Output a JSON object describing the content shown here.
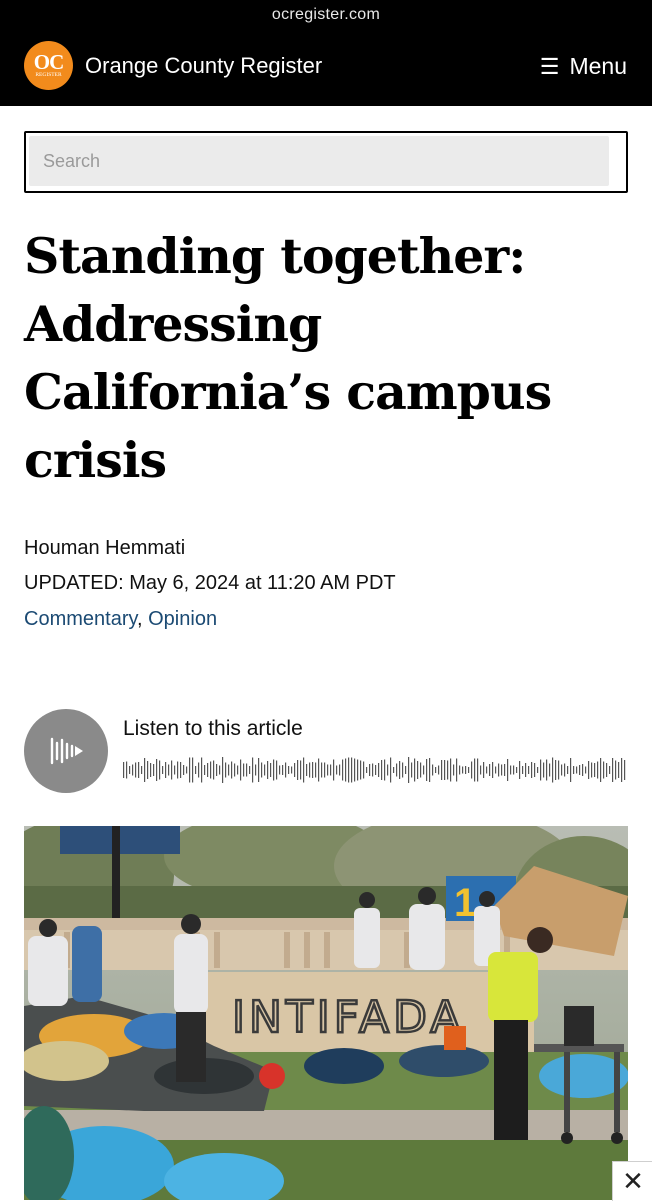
{
  "browser": {
    "url": "ocregister.com"
  },
  "header": {
    "logo_main": "OC",
    "logo_sub": "REGISTER",
    "site_name": "Orange County Register",
    "menu_icon": "☰",
    "menu_label": "Menu"
  },
  "search": {
    "placeholder": "Search",
    "value": ""
  },
  "article": {
    "headline": "Standing together: Addressing California’s campus crisis",
    "author": "Houman Hemmati",
    "updated": "UPDATED: May 6, 2024 at 11:20 AM PDT",
    "categories": [
      "Commentary",
      "Opinion"
    ],
    "category_separator": ", "
  },
  "audio": {
    "label": "Listen to this article",
    "icon": "audio-wave-icon"
  },
  "photo": {
    "graffiti_text": "INTIFADA",
    "banner_text": "1"
  },
  "ad": {
    "close_glyph": "✕"
  },
  "colors": {
    "topbar": "#000000",
    "logo": "#f28b1c",
    "link": "#1b4a73",
    "audio_button": "#8a8a8a"
  }
}
